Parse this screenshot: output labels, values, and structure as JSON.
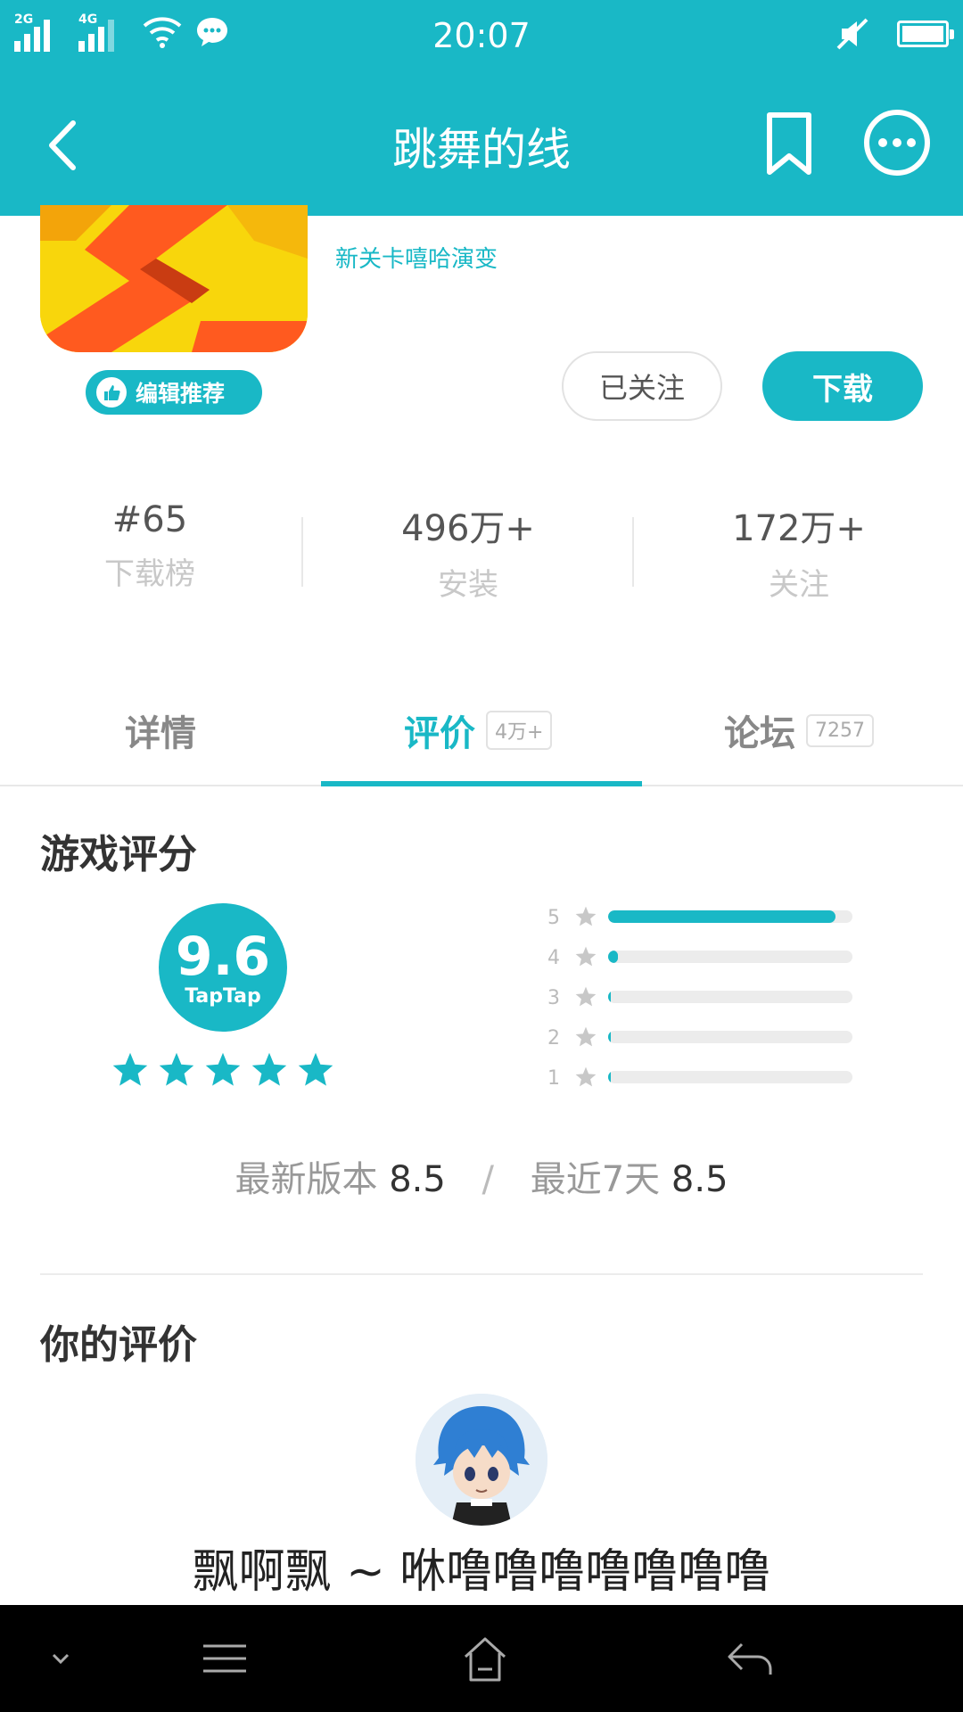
{
  "status_bar": {
    "time": "20:07",
    "network_1": "2G",
    "network_2": "4G",
    "icons": [
      "signal-icon",
      "signal-icon",
      "wifi-icon",
      "message-icon",
      "mute-icon",
      "battery-icon"
    ]
  },
  "header": {
    "title": "跳舞的线",
    "icons": [
      "back-icon",
      "bookmark-icon",
      "more-icon"
    ]
  },
  "app": {
    "subtitle": "新关卡嘻哈演变",
    "badge_label": "编辑推荐",
    "follow_label": "已关注",
    "download_label": "下载",
    "colors": {
      "accent": "#19b8c6"
    }
  },
  "stats": [
    {
      "value": "#65",
      "label": "下载榜"
    },
    {
      "value": "496万+",
      "label": "安装"
    },
    {
      "value": "172万+",
      "label": "关注"
    }
  ],
  "tabs": [
    {
      "label": "详情",
      "count": ""
    },
    {
      "label": "评价",
      "count": "4万+",
      "active": true
    },
    {
      "label": "论坛",
      "count": "7257"
    }
  ],
  "rating": {
    "section_title": "游戏评分",
    "score": "9.6",
    "brand": "TapTap",
    "stars": 5,
    "distribution": [
      {
        "level": "5",
        "fraction": 0.93
      },
      {
        "level": "4",
        "fraction": 0.04
      },
      {
        "level": "3",
        "fraction": 0.01
      },
      {
        "level": "2",
        "fraction": 0.005
      },
      {
        "level": "1",
        "fraction": 0.005
      }
    ],
    "latest_version_label": "最新版本",
    "latest_version_value": "8.5",
    "separator": "/",
    "recent_label": "最近7天",
    "recent_value": "8.5"
  },
  "your_review": {
    "section_title": "你的评价",
    "nickname": "飘啊飘 ~ 咻噜噜噜噜噜噜噜"
  },
  "nav_bar": {
    "icons": [
      "chevron-down-icon",
      "menu-icon",
      "home-icon",
      "back-arrow-icon"
    ]
  }
}
